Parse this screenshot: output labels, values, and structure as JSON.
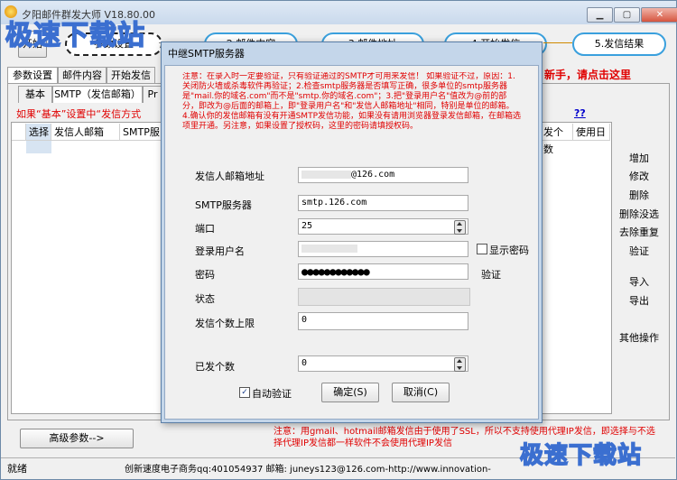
{
  "window": {
    "title": "夕阳邮件群发大师 V18.80.00",
    "min": "▁",
    "max": "▢",
    "close": "✕"
  },
  "toolbar": {
    "start": "开始",
    "steps": [
      "参数设置",
      "2.邮件内容",
      "3.邮件地址",
      "4.开始发信",
      "5.发信结果"
    ]
  },
  "tabs": [
    "参数设置",
    "邮件内容",
    "开始发信"
  ],
  "subtabs": [
    "基本",
    "SMTP（发信邮箱）",
    "Pr"
  ],
  "hint": "如果“基本”设置中“发信方式",
  "newbie": "新手，请点击这里",
  "qq": "??",
  "table": {
    "headers": [
      "选择",
      "发信人邮箱",
      "SMTP服务"
    ],
    "right_headers": [
      "发个数",
      "使用日"
    ]
  },
  "side_buttons": [
    "增加",
    "修改",
    "删除",
    "删除没选",
    "去除重复",
    "验证",
    "导入",
    "导出",
    "其他操作"
  ],
  "advanced": "高级参数-->",
  "bottom_note": "注意：用gmail、hotmail邮箱发信由于使用了SSL，所以不支持使用代理IP发信，即选择与不选择代理IP发信都一样软件不会使用代理IP发信",
  "statusbar": {
    "left": "就绪",
    "info": "创新速度电子商务qq:401054937 邮箱: juneys123@126.com-http://www.innovation-"
  },
  "dialog": {
    "title": "中继SMTP服务器",
    "warning": "注意：在录入时一定要验证，只有验证通过的SMTP才可用来发信！ 如果验证不过，原因：1.关闭防火墙或杀毒软件再验证；2.检查smtp服务器是否填写正确，很多单位的smtp服务器是\"mail.你的域名.com\"而不是\"smtp.你的域名.com\"；3.把\"登录用户名\"值改为@前的部分，即改为@后面的邮箱上，即\"登录用户名\"和\"发信人邮箱地址\"相同，特别是单位的邮箱。4.确认你的发信邮箱有没有开通SMTP发信功能，如果没有请用浏览器登录发信邮箱，在邮箱选项里开通。另注意，如果设置了授权码，这里的密码请填授权码。",
    "labels": {
      "sender": "发信人邮箱地址",
      "smtp": "SMTP服务器",
      "port": "端口",
      "user": "登录用户名",
      "pwd": "密码",
      "status": "状态",
      "limit": "发信个数上限",
      "sent": "已发个数"
    },
    "values": {
      "sender": "@126.com",
      "smtp": "smtp.126.com",
      "port": "25",
      "user": "",
      "pwd": "●●●●●●●●●●●●",
      "status": "",
      "limit": "0",
      "sent": "0"
    },
    "show_pwd": "显示密码",
    "verify": "验证",
    "auto_verify": "自动验证",
    "auto_verify_checked": true,
    "ok": "确定(S)",
    "cancel": "取消(C)"
  },
  "watermark": "极速下载站"
}
